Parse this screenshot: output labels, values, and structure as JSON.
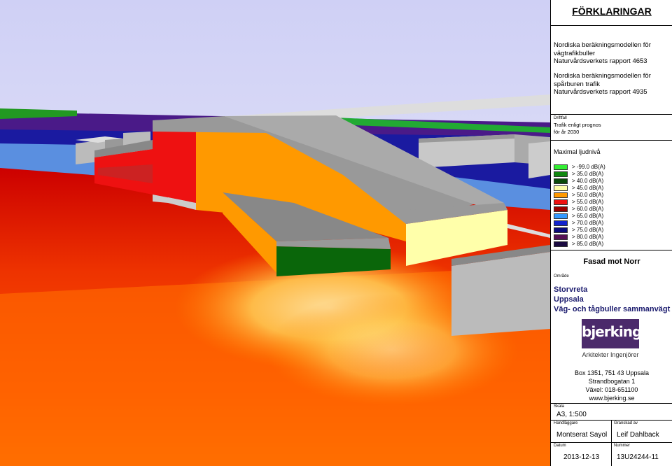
{
  "panel": {
    "title": "FÖRKLARINGAR",
    "model1": [
      "Nordiska beräkningsmodellen för",
      "vägtrafikbuller",
      "Naturvårdsverkets rapport 4653"
    ],
    "model2": [
      "Nordiska beräkningsmodellen för",
      "spårburen trafik",
      "Naturvårdsverkets rapport 4935"
    ],
    "driftfall_label": "Driftfall",
    "driftfall": [
      "Trafik enligt prognos",
      "för år 2030"
    ],
    "legend_title": "Maximal ljudnivå",
    "legend": [
      {
        "label": ">  -99.0 dB(A)",
        "color": "#33ee33"
      },
      {
        "label": ">  35.0 dB(A)",
        "color": "#118811"
      },
      {
        "label": ">  40.0 dB(A)",
        "color": "#0a4a0a"
      },
      {
        "label": ">  45.0 dB(A)",
        "color": "#ffffaa"
      },
      {
        "label": ">  50.0 dB(A)",
        "color": "#ff9900"
      },
      {
        "label": ">  55.0 dB(A)",
        "color": "#ee1111"
      },
      {
        "label": ">  60.0 dB(A)",
        "color": "#990000"
      },
      {
        "label": ">  65.0 dB(A)",
        "color": "#3399ff"
      },
      {
        "label": ">  70.0 dB(A)",
        "color": "#1122cc"
      },
      {
        "label": ">  75.0 dB(A)",
        "color": "#0a0a7a"
      },
      {
        "label": ">  80.0 dB(A)",
        "color": "#551155"
      },
      {
        "label": ">  85.0 dB(A)",
        "color": "#1a0a40"
      }
    ],
    "view_title": "Fasad mot Norr",
    "omrade_label": "Område",
    "omrade": [
      "Storvreta",
      "Uppsala",
      "Väg- och tågbuller sammanvägt"
    ],
    "logo_text": "bjerking",
    "logo_sub": "Arkitekter  Ingenjörer",
    "address": [
      "Box 1351, 751 43 Uppsala",
      "Strandbogatan 1",
      "Växel: 018-651100",
      "www.bjerking.se"
    ],
    "skala_label": "Skala",
    "skala": "A3, 1:500",
    "handlaggare_label": "Handläggare",
    "handlaggare": "Montserat Sayol",
    "granskad_label": "Granskad av",
    "granskad": "Leif Dahlback",
    "datum_label": "Datum",
    "datum": "2013-12-13",
    "nummer_label": "Nummer",
    "nummer": "13U24244-11"
  }
}
